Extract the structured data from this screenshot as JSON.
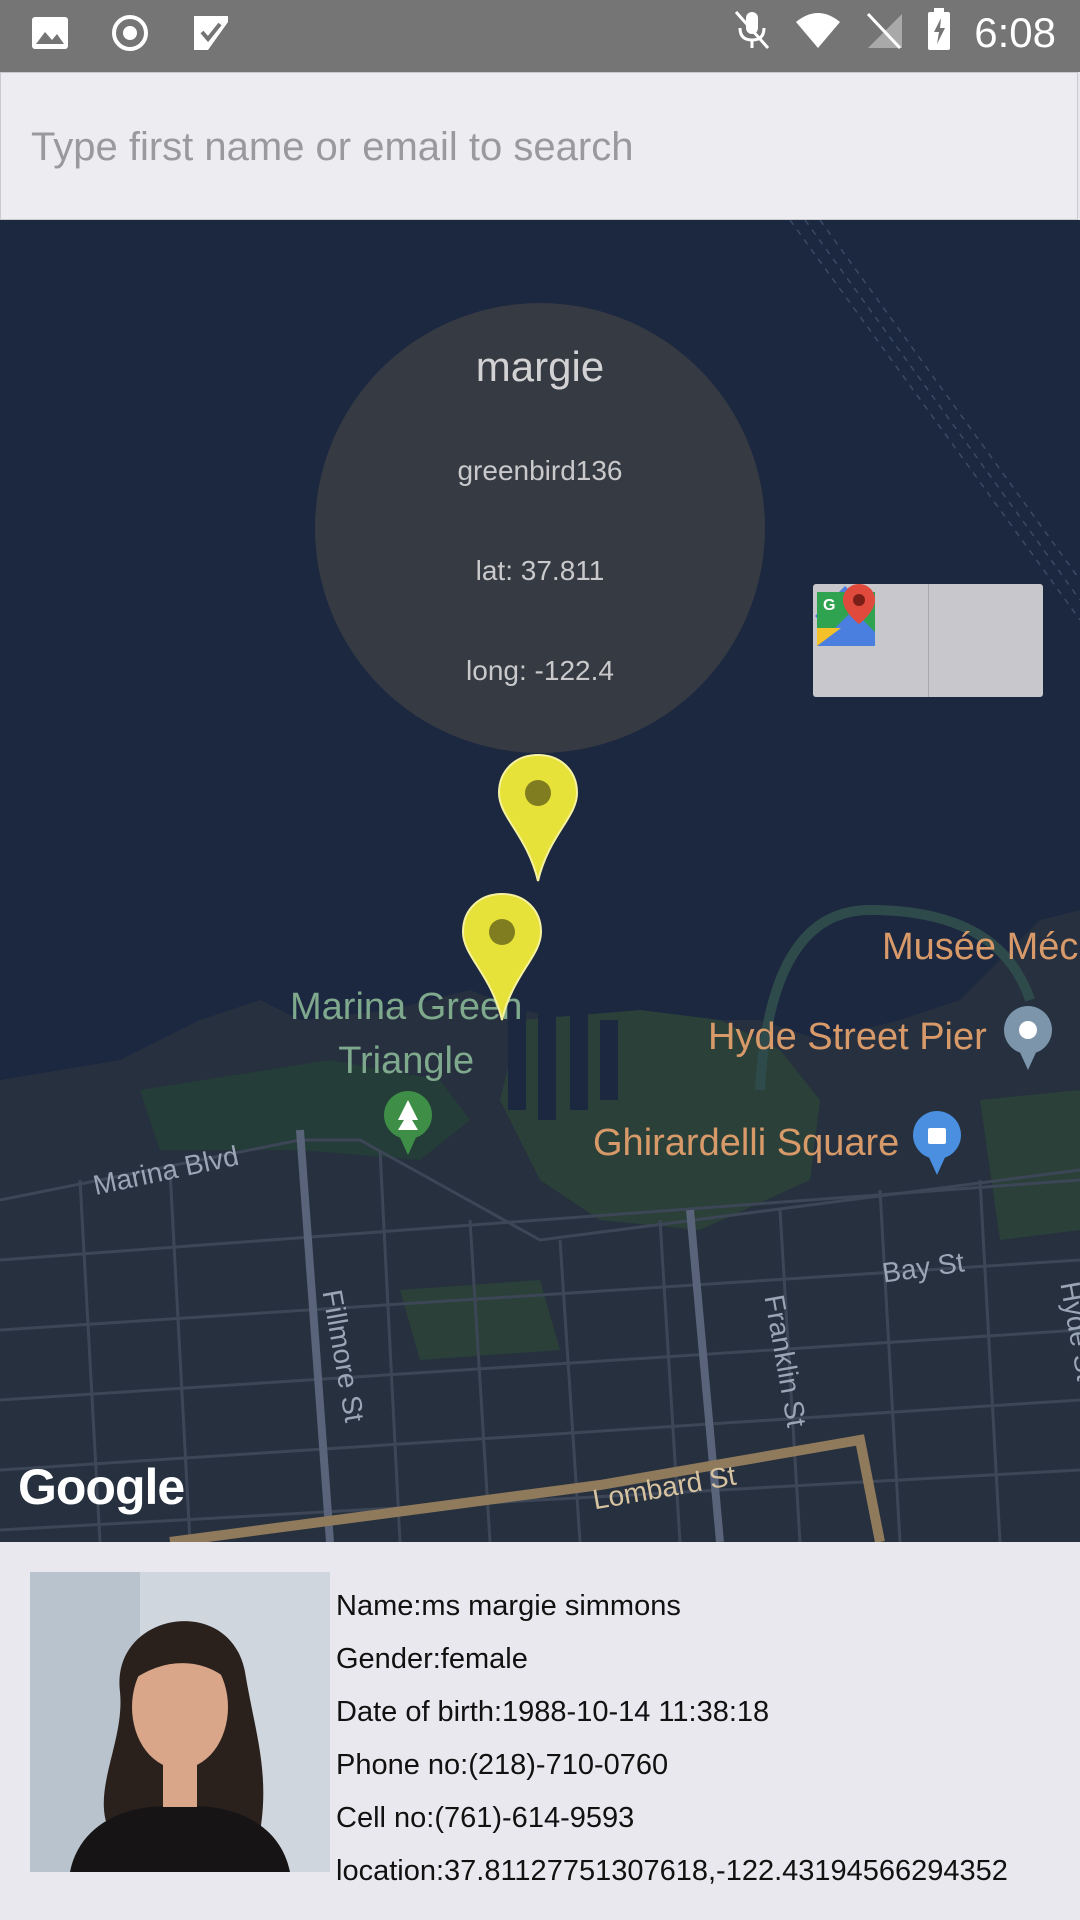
{
  "status_bar": {
    "time": "6:08",
    "left_icons": [
      "image-icon",
      "record-icon",
      "play-store-icon"
    ],
    "right_icons": [
      "mute-icon",
      "wifi-icon",
      "no-sim-icon",
      "battery-icon"
    ]
  },
  "search": {
    "placeholder": "Type first name or email to search",
    "value": ""
  },
  "map": {
    "info_bubble": {
      "name": "margie",
      "username": "greenbird136",
      "lat": "lat: 37.811",
      "long": "long: -122.4"
    },
    "labels": {
      "marina_green": "Marina Green\nTriangle",
      "musee": "Musée Méc",
      "hyde_pier": "Hyde Street Pier",
      "ghirardelli": "Ghirardelli Square",
      "marina_blvd": "Marina Blvd",
      "bay_st": "Bay St",
      "hyde_st": "Hyde St",
      "fillmore_st": "Fillmore St",
      "franklin_st": "Franklin St",
      "lombard_st": "Lombard St"
    },
    "attribution": "Google",
    "colors": {
      "water": "#1c2740",
      "marker": "#e6e23a",
      "bubble": "#363a42"
    }
  },
  "details": {
    "name": "Name:ms margie simmons",
    "gender": "Gender:female",
    "dob": "Date of birth:1988-10-14 11:38:18",
    "phone": "Phone no:(218)-710-0760",
    "cell": "Cell no:(761)-614-9593",
    "location": "location:37.81127751307618,-122.43194566294352"
  }
}
